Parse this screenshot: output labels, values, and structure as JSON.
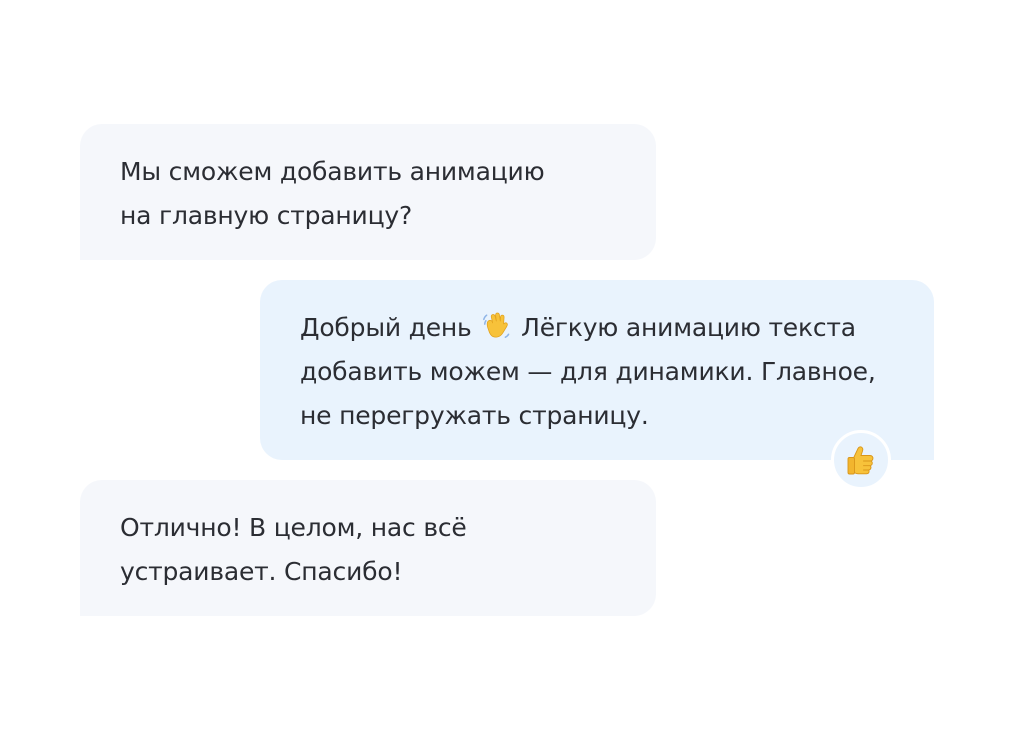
{
  "messages": [
    {
      "direction": "incoming",
      "lines": [
        "Мы сможем добавить анимацию",
        "на главную страницу?"
      ]
    },
    {
      "direction": "outgoing",
      "line1_before_emoji": "Добрый день",
      "line1_emoji": "waving-hand-icon",
      "line1_after_emoji": "Лёгкую анимацию текста",
      "lines_rest": [
        "добавить можем — для динамики. Главное,",
        "не перегружать страницу."
      ],
      "reaction": "thumbs-up-icon"
    },
    {
      "direction": "incoming",
      "lines": [
        "Отлично! В целом, нас всё",
        "устраивает. Спасибо!"
      ]
    }
  ],
  "colors": {
    "incoming_bg": "#f5f7fb",
    "outgoing_bg": "#e9f3fd",
    "text": "#2b2d33"
  }
}
